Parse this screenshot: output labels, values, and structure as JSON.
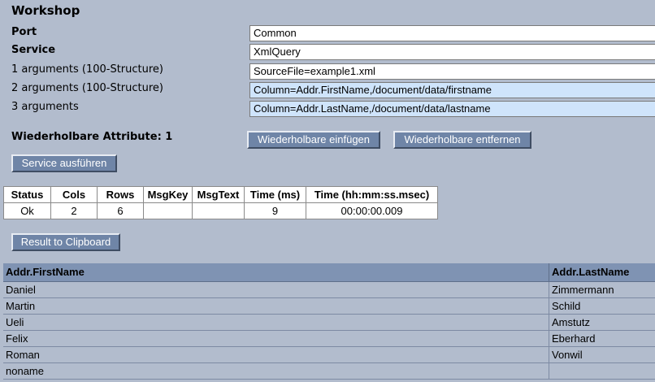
{
  "workshop": {
    "title": "Workshop",
    "port_label": "Port",
    "port_value": "Common",
    "service_label": "Service",
    "service_value": "XmlQuery",
    "arguments": [
      {
        "label": "1 arguments (100-Structure)",
        "value": "SourceFile=example1.xml"
      },
      {
        "label": "2 arguments (100-Structure)",
        "value": "Column=Addr.FirstName,/document/data/firstname"
      },
      {
        "label": "3 arguments",
        "value": "Column=Addr.LastName,/document/data/lastname"
      }
    ],
    "repeatable_label": "Wiederholbare Attribute: 1",
    "insert_button": "Wiederholbare einfügen",
    "remove_button": "Wiederholbare entfernen",
    "execute_button": "Service ausführen"
  },
  "status_table": {
    "headers": [
      "Status",
      "Cols",
      "Rows",
      "MsgKey",
      "MsgText",
      "Time (ms)",
      "Time (hh:mm:ss.msec)"
    ],
    "row": [
      "Ok",
      "2",
      "6",
      "",
      "",
      "9",
      "00:00:00.009"
    ]
  },
  "clipboard_button": "Result to Clipboard",
  "results": {
    "headers": [
      "Addr.FirstName",
      "Addr.LastName"
    ],
    "rows": [
      [
        "Daniel",
        "Zimmermann"
      ],
      [
        "Martin",
        "Schild"
      ],
      [
        "Ueli",
        "Amstutz"
      ],
      [
        "Felix",
        "Eberhard"
      ],
      [
        "Roman",
        "Vonwil"
      ],
      [
        "noname",
        ""
      ]
    ]
  }
}
